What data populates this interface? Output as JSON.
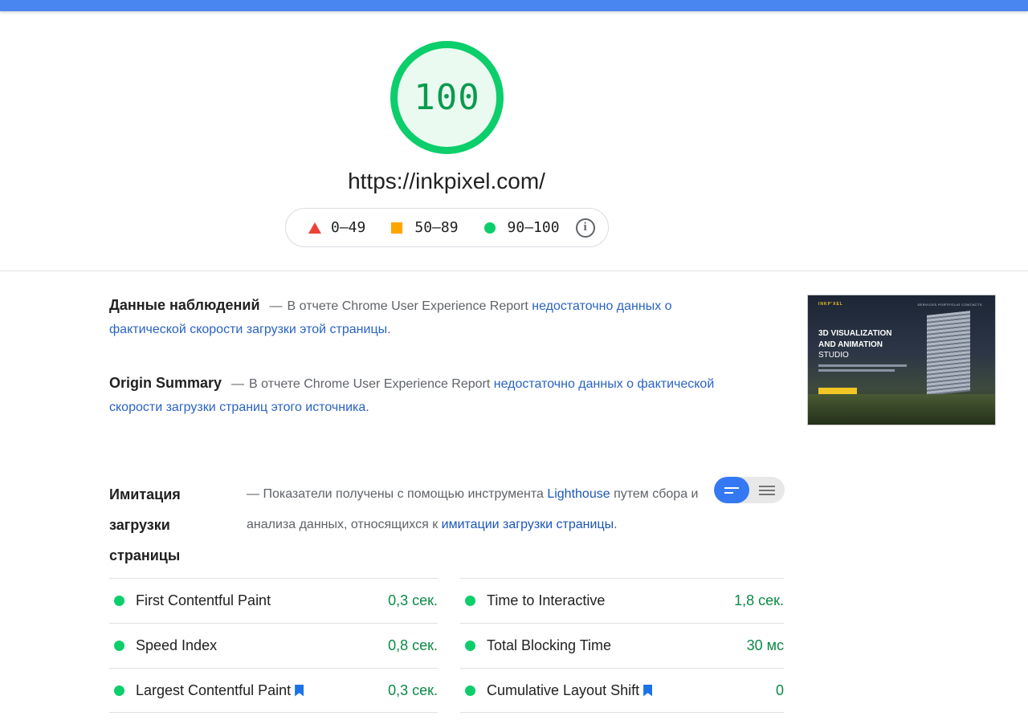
{
  "score": {
    "value": "100",
    "url": "https://inkpixel.com/"
  },
  "legend": {
    "fail": "0–49",
    "average": "50–89",
    "pass": "90–100"
  },
  "field_data": {
    "title": "Данные наблюдений",
    "dash": "—",
    "text": "В отчете Chrome User Experience Report",
    "link": "недостаточно данных о фактической скорости загрузки этой страницы",
    "end": "."
  },
  "origin_summary": {
    "title": "Origin Summary",
    "dash": "—",
    "text": "В отчете Chrome User Experience Report",
    "link": "недостаточно данных о фактической скорости загрузки страниц этого источника",
    "end": "."
  },
  "thumbnail": {
    "logo": "INKP'XEL",
    "menu": "SERVICES   PORTFOLIO   CONTACTS",
    "headline": "3D VISUALIZATION AND ANIMATION",
    "subheadline": "STUDIO"
  },
  "lab_data": {
    "title": "Имитация загрузки страницы",
    "dash": "—",
    "text": "Показатели получены с помощью инструмента",
    "link1": "Lighthouse",
    "text2": "путем сбора и анализа данных, относящихся к",
    "link2": "имитации загрузки страницы",
    "end": "."
  },
  "metrics_left": [
    {
      "name": "First Contentful Paint",
      "value": "0,3 сек."
    },
    {
      "name": "Speed Index",
      "value": "0,8 сек."
    },
    {
      "name": "Largest Contentful Paint",
      "value": "0,3 сек."
    }
  ],
  "metrics_right": [
    {
      "name": "Time to Interactive",
      "value": "1,8 сек."
    },
    {
      "name": "Total Blocking Time",
      "value": "30 мс"
    },
    {
      "name": "Cumulative Layout Shift",
      "value": "0"
    }
  ],
  "colors": {
    "pass": "#0cce6b",
    "average": "#ffa400",
    "fail": "#eb4335",
    "accent": "#3479f3"
  }
}
